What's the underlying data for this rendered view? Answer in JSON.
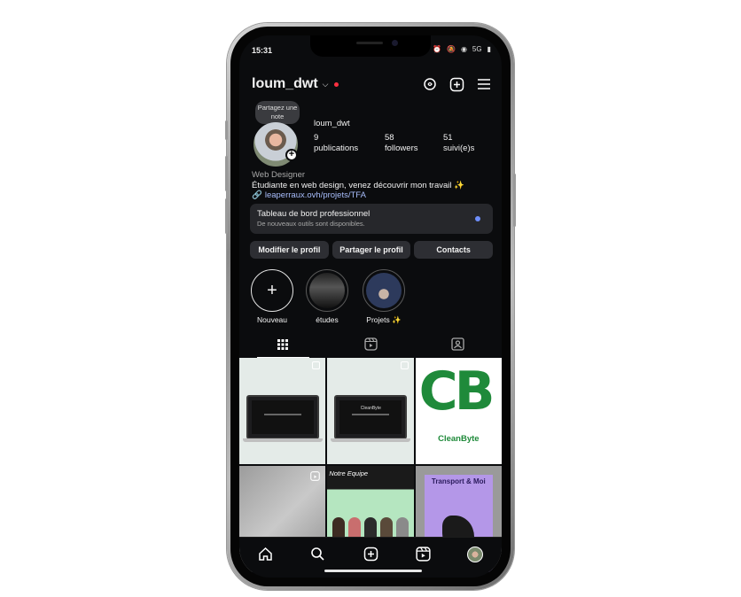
{
  "status": {
    "time": "15:31",
    "icons": [
      "alarm-icon",
      "mute-icon",
      "wifi-icon",
      "signal-icon",
      "battery-icon"
    ],
    "signal_text": "5G"
  },
  "header": {
    "username": "loum_dwt",
    "icons": [
      "threads-icon",
      "create-icon",
      "menu-icon"
    ]
  },
  "profile": {
    "note": "Partagez une note",
    "name": "loum_dwt",
    "stats": [
      {
        "value": "9",
        "label": "publications"
      },
      {
        "value": "58",
        "label": "followers"
      },
      {
        "value": "51",
        "label": "suivi(e)s"
      }
    ],
    "category": "Web Designer",
    "bio": "Étudiante en web design, venez découvrir mon travail ✨",
    "link": "leaperraux.ovh/projets/TFA"
  },
  "dashboard": {
    "title": "Tableau de bord professionnel",
    "subtitle": "De nouveaux outils sont disponibles."
  },
  "actions": {
    "edit": "Modifier le profil",
    "share": "Partager le profil",
    "contacts": "Contacts"
  },
  "highlights": [
    {
      "label": "Nouveau"
    },
    {
      "label": "études"
    },
    {
      "label": "Projets ✨"
    }
  ],
  "tabs": [
    "grid-icon",
    "reels-icon",
    "tagged-icon"
  ],
  "posts": {
    "p2_title": "CleanByte",
    "p3_brand": "CleanByte",
    "p3_logo": "CB",
    "p5_title": "Notre Equipe",
    "p6_title": "Transport & Moi"
  },
  "nav": [
    "home-icon",
    "search-icon",
    "create-icon",
    "reels-icon",
    "profile-avatar"
  ],
  "colors": {
    "background": "#0b0c0e",
    "accent": "#6e8efb",
    "link": "#a8bdfb",
    "brand_green": "#1f8a3a",
    "notification": "#ff3040"
  }
}
